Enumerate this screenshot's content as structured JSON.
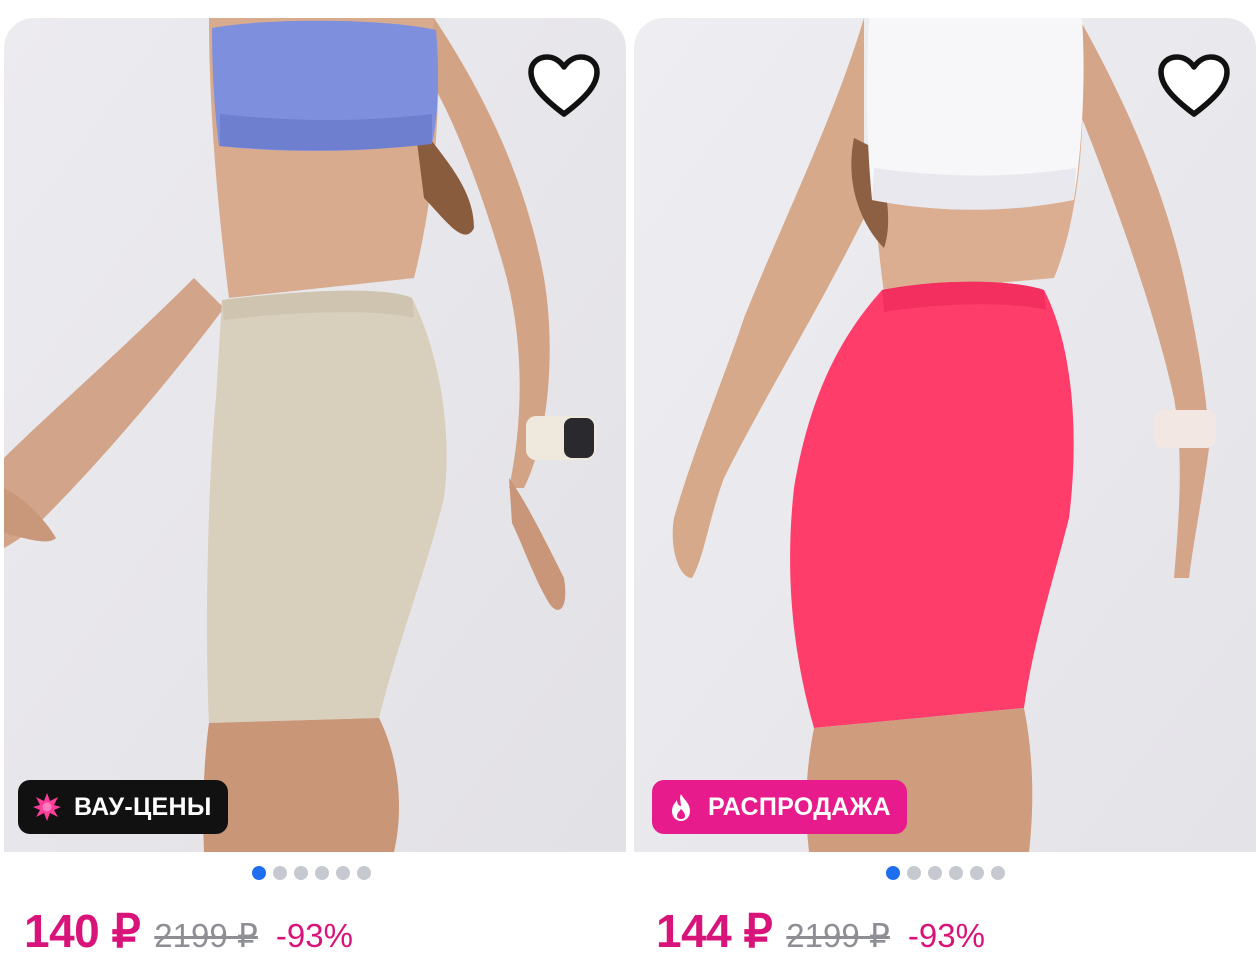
{
  "products": [
    {
      "badge": {
        "label": "ВАУ-ЦЕНЫ",
        "icon": "starburst-icon",
        "color": "#111111"
      },
      "shorts_color": "#d9cfbd",
      "top_color": "#7e8fde",
      "image_dots": {
        "count": 6,
        "active": 0
      },
      "price": "140 ₽",
      "old_price": "2199 ₽",
      "discount": "-93%"
    },
    {
      "badge": {
        "label": "РАСПРОДАЖА",
        "icon": "flame-icon",
        "color": "#e81b8c"
      },
      "shorts_color": "#ff3d6b",
      "top_color": "#f7f7f9",
      "image_dots": {
        "count": 6,
        "active": 0
      },
      "price": "144 ₽",
      "old_price": "2199 ₽",
      "discount": "-93%"
    }
  ],
  "colors": {
    "price": "#d8147a",
    "dot_active": "#1f6ef0",
    "dot_inactive": "#c7c9d1"
  }
}
